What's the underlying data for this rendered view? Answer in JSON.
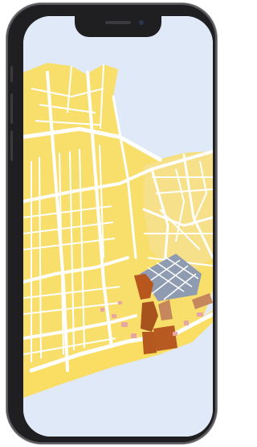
{
  "device": {
    "model": "smartphone-notch",
    "frame_color": "#1f1f21"
  },
  "map": {
    "water_color": "#dfe9f7",
    "land_color": "#f8de6a",
    "road_color": "#ffffff",
    "district_color": "#f7e08a",
    "building_colors": [
      "#b7561d",
      "#c7875d",
      "#8e9bb0",
      "#e7a6a4"
    ],
    "labels": []
  }
}
